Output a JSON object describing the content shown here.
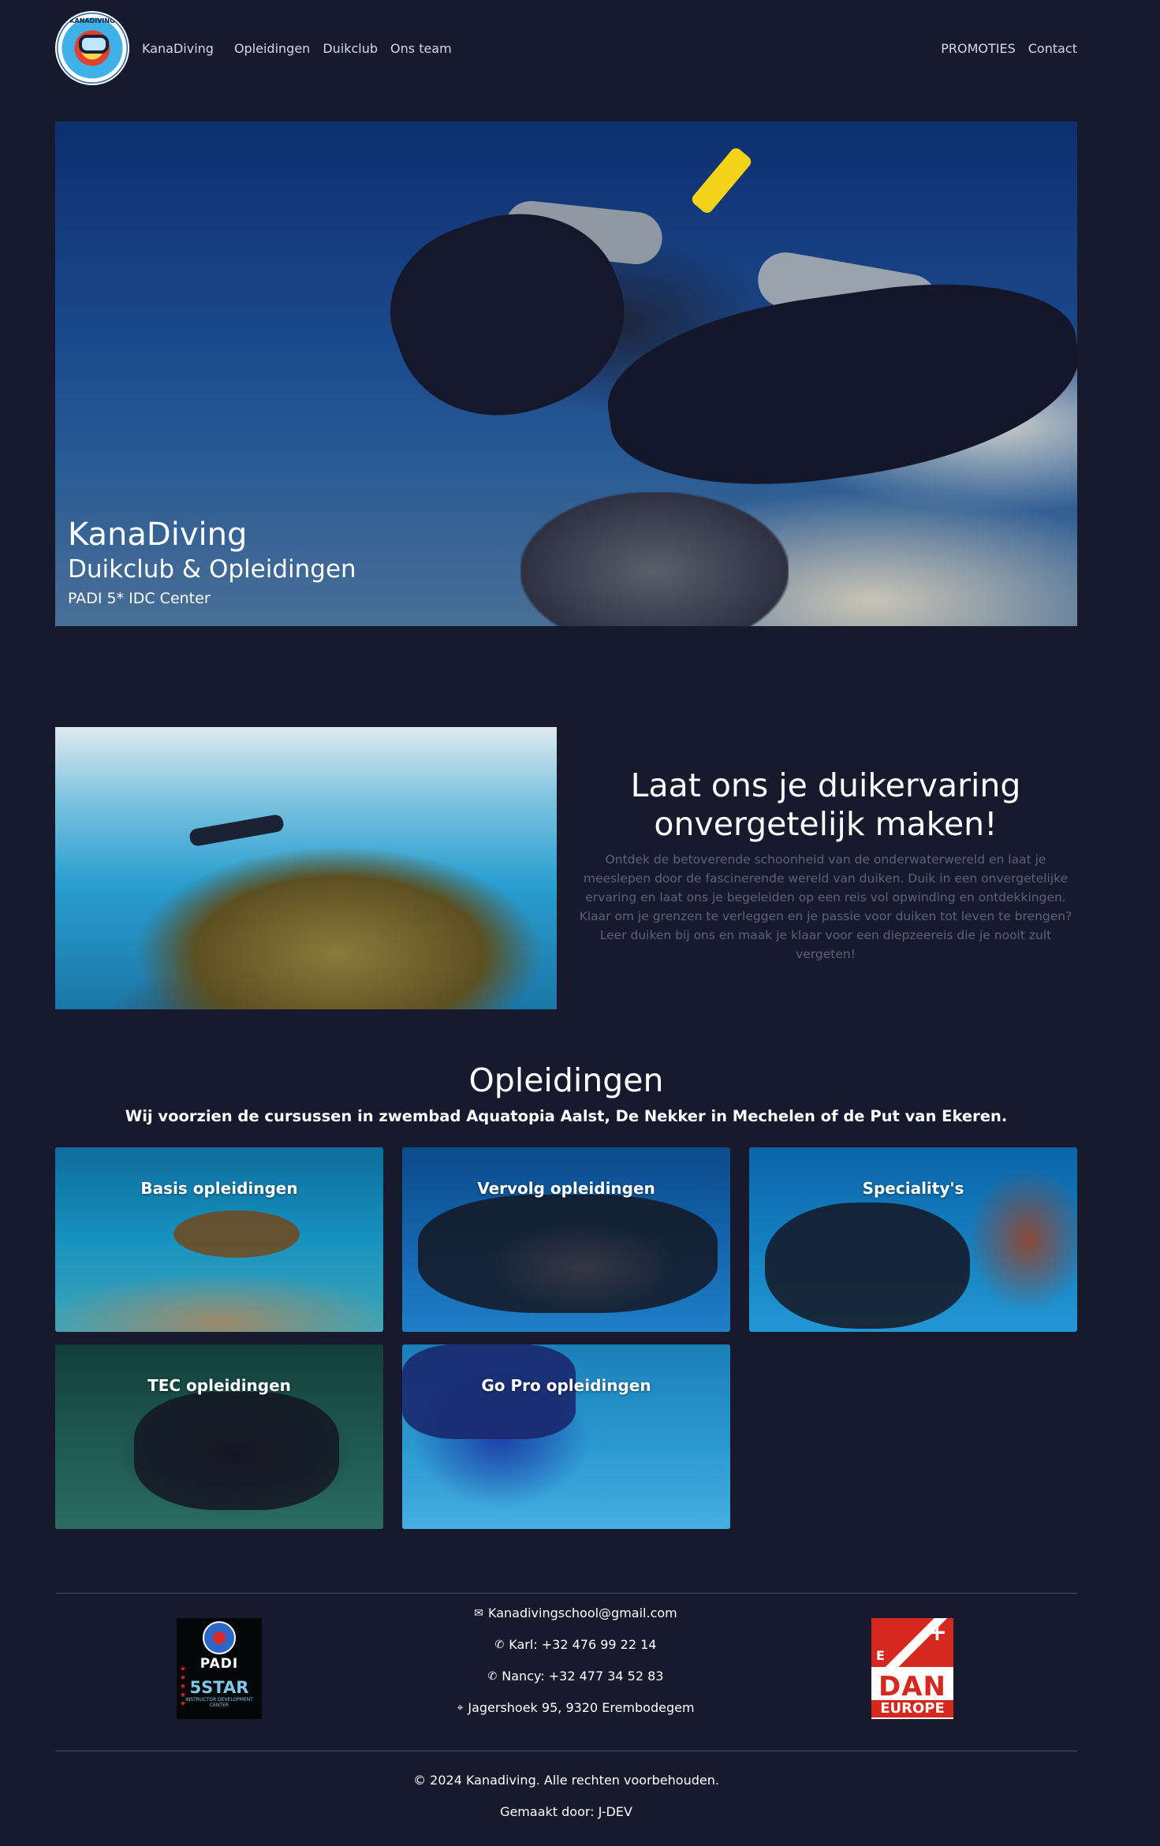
{
  "nav": {
    "logo_text": "KANADIVING",
    "brand": "KanaDiving",
    "links": [
      "Opleidingen",
      "Duikclub",
      "Ons team"
    ],
    "right_links": [
      "PROMOTIES",
      "Contact"
    ]
  },
  "hero": {
    "title": "KanaDiving",
    "subtitle": "Duikclub & Opleidingen",
    "tagline": "PADI 5* IDC Center"
  },
  "about": {
    "title": "Laat ons je duikervaring onvergetelijk maken!",
    "body": "Ontdek de betoverende schoonheid van de onderwaterwereld en laat je meeslepen door de fascinerende wereld van duiken. Duik in een onvergetelijke ervaring en laat ons je begeleiden op een reis vol opwinding en ontdekkingen. Klaar om je grenzen te verleggen en je passie voor duiken tot leven te brengen? Leer duiken bij ons en maak je klaar voor een diepzeereis die je nooit zult vergeten!"
  },
  "courses": {
    "title": "Opleidingen",
    "subtitle": "Wij voorzien de cursussen in zwembad Aquatopia Aalst, De Nekker in Mechelen of de Put van Ekeren.",
    "cards": [
      "Basis opleidingen",
      "Vervolg opleidingen",
      "Speciality's",
      "TEC opleidingen",
      "Go Pro opleidingen"
    ]
  },
  "footer": {
    "padi_word": "PADI",
    "padi_five_star": "5STAR",
    "padi_idc": "INSTRUCTOR DEVELOPMENT CENTER",
    "dan_word": "DAN",
    "dan_europe": "EUROPE",
    "email": "Kanadivingschool@gmail.com",
    "phone_karl": "Karl: +32 476 99 22 14",
    "phone_nancy": "Nancy: +32 477 34 52 83",
    "address": "Jagershoek 95, 9320 Erembodegem",
    "copyright": "© 2024 Kanadiving. Alle rechten voorbehouden.",
    "made_by": "Gemaakt door: J-DEV"
  },
  "colors": {
    "background": "#171a2d",
    "muted_text": "#5e6278",
    "divider": "#474b62"
  }
}
